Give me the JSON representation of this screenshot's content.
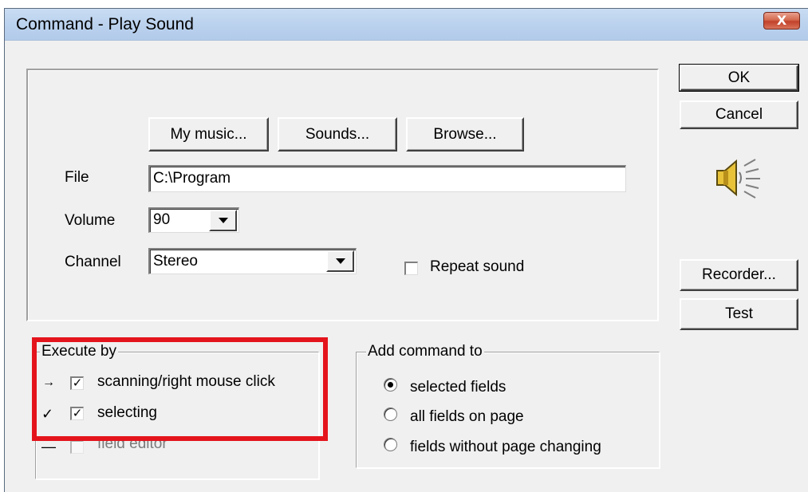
{
  "window": {
    "title": "Command - Play Sound",
    "close_glyph": "X"
  },
  "buttons": {
    "ok": "OK",
    "cancel": "Cancel",
    "recorder": "Recorder...",
    "test": "Test",
    "my_music": "My music...",
    "sounds": "Sounds...",
    "browse": "Browse..."
  },
  "form": {
    "file_label": "File",
    "file_value": "C:\\Program",
    "volume_label": "Volume",
    "volume_value": "90",
    "channel_label": "Channel",
    "channel_value": "Stereo",
    "repeat_label": "Repeat sound",
    "repeat_checked": false
  },
  "execute_by": {
    "title": "Execute by",
    "items": [
      {
        "marker": "→",
        "label": "scanning/right mouse click",
        "checked": true
      },
      {
        "marker": "✓",
        "label": "selecting",
        "checked": true
      },
      {
        "marker": "—",
        "label": "field editor",
        "checked": false
      }
    ]
  },
  "add_command_to": {
    "title": "Add command to",
    "options": [
      {
        "label": "selected fields",
        "selected": true
      },
      {
        "label": "all fields on page",
        "selected": false
      },
      {
        "label": "fields without page changing",
        "selected": false
      }
    ]
  },
  "icons": {
    "speaker": "speaker-icon"
  },
  "colors": {
    "highlight": "#e4141c",
    "title_bar": "#bcd3ee",
    "close": "#c2412a"
  }
}
